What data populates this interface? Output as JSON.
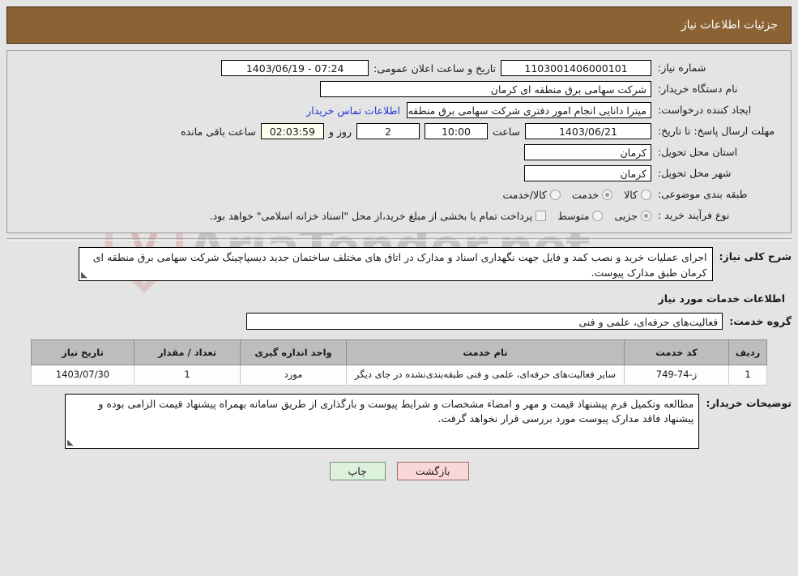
{
  "header": {
    "title": "جزئیات اطلاعات نیاز"
  },
  "watermark": {
    "text": "AriaTender.net",
    "logo_letter": "V"
  },
  "form": {
    "need_number": {
      "label": "شماره نیاز:",
      "value": "1103001406000101"
    },
    "public_announce": {
      "label": "تاریخ و ساعت اعلان عمومی:",
      "value": "07:24 - 1403/06/19"
    },
    "buyer_org": {
      "label": "نام دستگاه خریدار:",
      "value": "شرکت سهامی برق منطقه ای کرمان"
    },
    "request_creator": {
      "label": "ایجاد کننده درخواست:",
      "value": "میترا دانایی انجام امور دفتری شرکت سهامی برق منطقه ای کرمان"
    },
    "buyer_contact_link": "اطلاعات تماس خریدار",
    "deadline": {
      "label": "مهلت ارسال پاسخ: تا تاریخ:",
      "date": "1403/06/21",
      "time_label": "ساعت",
      "time": "10:00",
      "days": "2",
      "days_suffix": "روز و",
      "counter": "02:03:59",
      "counter_suffix": "ساعت باقی مانده"
    },
    "delivery_province": {
      "label": "استان محل تحویل:",
      "value": "کرمان"
    },
    "delivery_city": {
      "label": "شهر محل تحویل:",
      "value": "کرمان"
    },
    "subject_category": {
      "label": "طبقه بندی موضوعی:",
      "options": [
        "کالا",
        "خدمت",
        "کالا/خدمت"
      ],
      "selected": "خدمت"
    },
    "purchase_process": {
      "label": "نوع فرآیند خرید :",
      "options": [
        "جزیی",
        "متوسط"
      ],
      "selected": "جزیی",
      "checkbox_label": "پرداخت تمام یا بخشی از مبلغ خرید،از محل \"اسناد خزانه اسلامی\" خواهد بود.",
      "checkbox_checked": false
    }
  },
  "description": {
    "label": "شرح کلی نیاز:",
    "value": "اجرای عملیات خرید و نصب کمد و فایل جهت نگهداری اسناد و مدارک در اتاق های مختلف ساختمان جدید دیسپاچینگ شرکت سهامی برق منطقه ای کرمان  طبق مدارک پیوست."
  },
  "services": {
    "heading": "اطلاعات خدمات مورد نیاز",
    "group": {
      "label": "گروه خدمت:",
      "value": "فعالیت‌های حرفه‌ای، علمی و فنی"
    },
    "columns": [
      "ردیف",
      "کد خدمت",
      "نام خدمت",
      "واحد اندازه گیری",
      "تعداد / مقدار",
      "تاریخ نیاز"
    ],
    "rows": [
      {
        "radif": "1",
        "code": "ز-74-749",
        "name": "سایر فعالیت‌های حرفه‌ای، علمی و فنی طبقه‌بندی‌نشده در جای دیگر",
        "unit": "مورد",
        "qty": "1",
        "date": "1403/07/30"
      }
    ]
  },
  "notes": {
    "label": "توضیحات خریدار:",
    "value": "مطالعه وتکمیل فرم پیشنهاد قیمت و مهر و امضاء مشخصات و شرایط پیوست و بارگذاری از طریق سامانه بهمراه پیشنهاد قیمت الزامی بوده و پیشنهاد فاقد مدارک پیوست مورد بررسی قرار نخواهد گرفت."
  },
  "footer": {
    "print_label": "چاپ",
    "back_label": "بازگشت"
  }
}
